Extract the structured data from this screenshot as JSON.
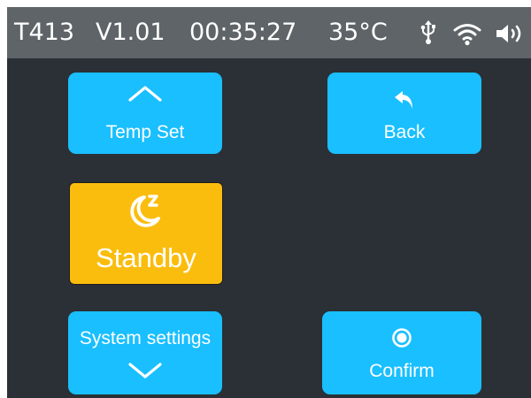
{
  "status_bar": {
    "model": "T413",
    "version": "V1.01",
    "time": "00:35:27",
    "temperature": "35°C",
    "icons": [
      "usb-icon",
      "wifi-icon",
      "speaker-icon"
    ]
  },
  "buttons": {
    "temp_set": {
      "label": "Temp Set",
      "icon": "chevron-up-icon"
    },
    "back": {
      "label": "Back",
      "icon": "back-arrow-icon"
    },
    "standby": {
      "label": "Standby",
      "icon": "moon-sleep-icon"
    },
    "system_settings": {
      "label": "System settings",
      "icon": "chevron-down-icon"
    },
    "confirm": {
      "label": "Confirm",
      "icon": "radio-dot-icon"
    }
  },
  "colors": {
    "background": "#2a3035",
    "status_bar": "#5e6468",
    "button": "#19bfff",
    "selected_button": "#fbbd0d",
    "text": "#ffffff"
  }
}
